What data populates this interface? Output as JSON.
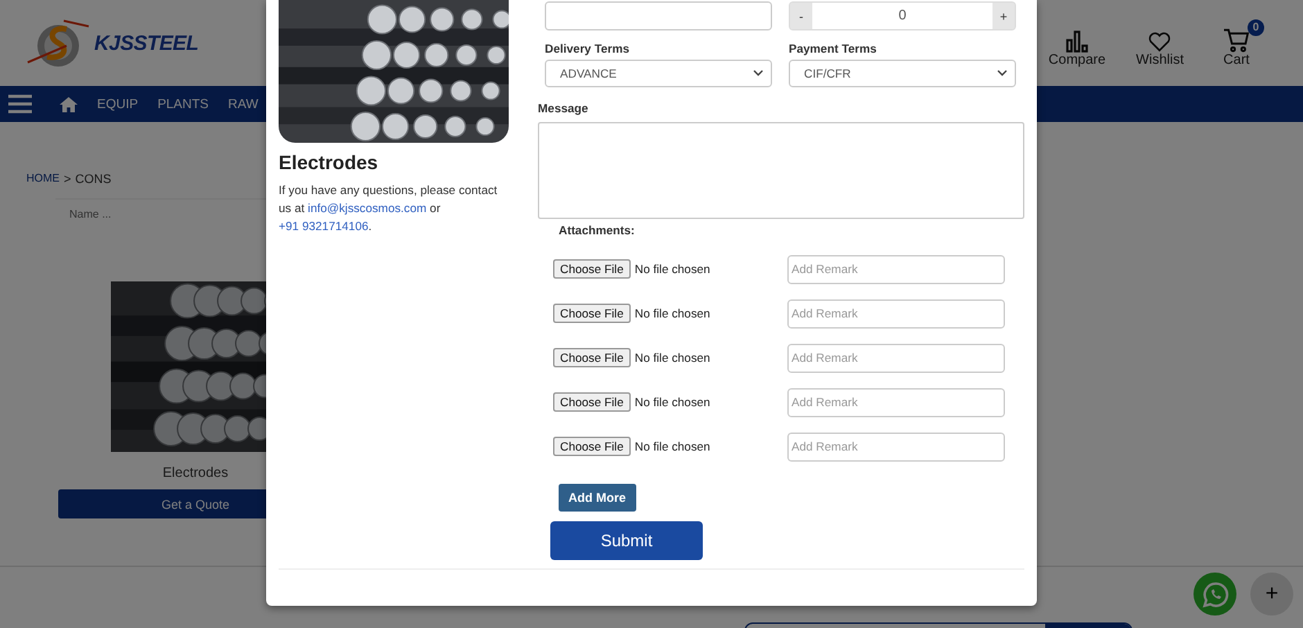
{
  "header": {
    "logo_text": "KJSSTEEL",
    "actions": [
      {
        "kind": "compare",
        "label": "Compare"
      },
      {
        "kind": "wishlist",
        "label": "Wishlist"
      },
      {
        "kind": "cart",
        "label": "Cart",
        "badge": "0"
      }
    ]
  },
  "nav": {
    "items": [
      "EQUIP",
      "PLANTS",
      "RAW"
    ]
  },
  "breadcrumb": {
    "items": [
      "HOME",
      "CONS"
    ],
    "separator": ">"
  },
  "filter": {
    "placeholder": "Name ..."
  },
  "product": {
    "name": "Electrodes",
    "button": "Get a Quote"
  },
  "modal": {
    "product_title": "Electrodes",
    "contact_text": "If you have any questions, please contact us at",
    "email": "info@kjsscosmos.com",
    "or_text": "or",
    "phone": "+91 9321714106",
    "end_text": ".",
    "quantity": {
      "decrement": "-",
      "value": "0",
      "increment": "+"
    },
    "delivery_terms": {
      "label": "Delivery Terms",
      "value": "ADVANCE"
    },
    "payment_terms": {
      "label": "Payment Terms",
      "value": "CIF/CFR"
    },
    "message": {
      "label": "Message"
    },
    "attachments": {
      "label": "Attachments:",
      "rows": [
        {
          "button": "Choose File",
          "status": "No file chosen",
          "remark_placeholder": "Add Remark"
        },
        {
          "button": "Choose File",
          "status": "No file chosen",
          "remark_placeholder": "Add Remark"
        },
        {
          "button": "Choose File",
          "status": "No file chosen",
          "remark_placeholder": "Add Remark"
        },
        {
          "button": "Choose File",
          "status": "No file chosen",
          "remark_placeholder": "Add Remark"
        },
        {
          "button": "Choose File",
          "status": "No file chosen",
          "remark_placeholder": "Add Remark"
        }
      ]
    },
    "add_more": "Add More",
    "submit": "Submit"
  },
  "floating": {
    "add_button": "+"
  }
}
